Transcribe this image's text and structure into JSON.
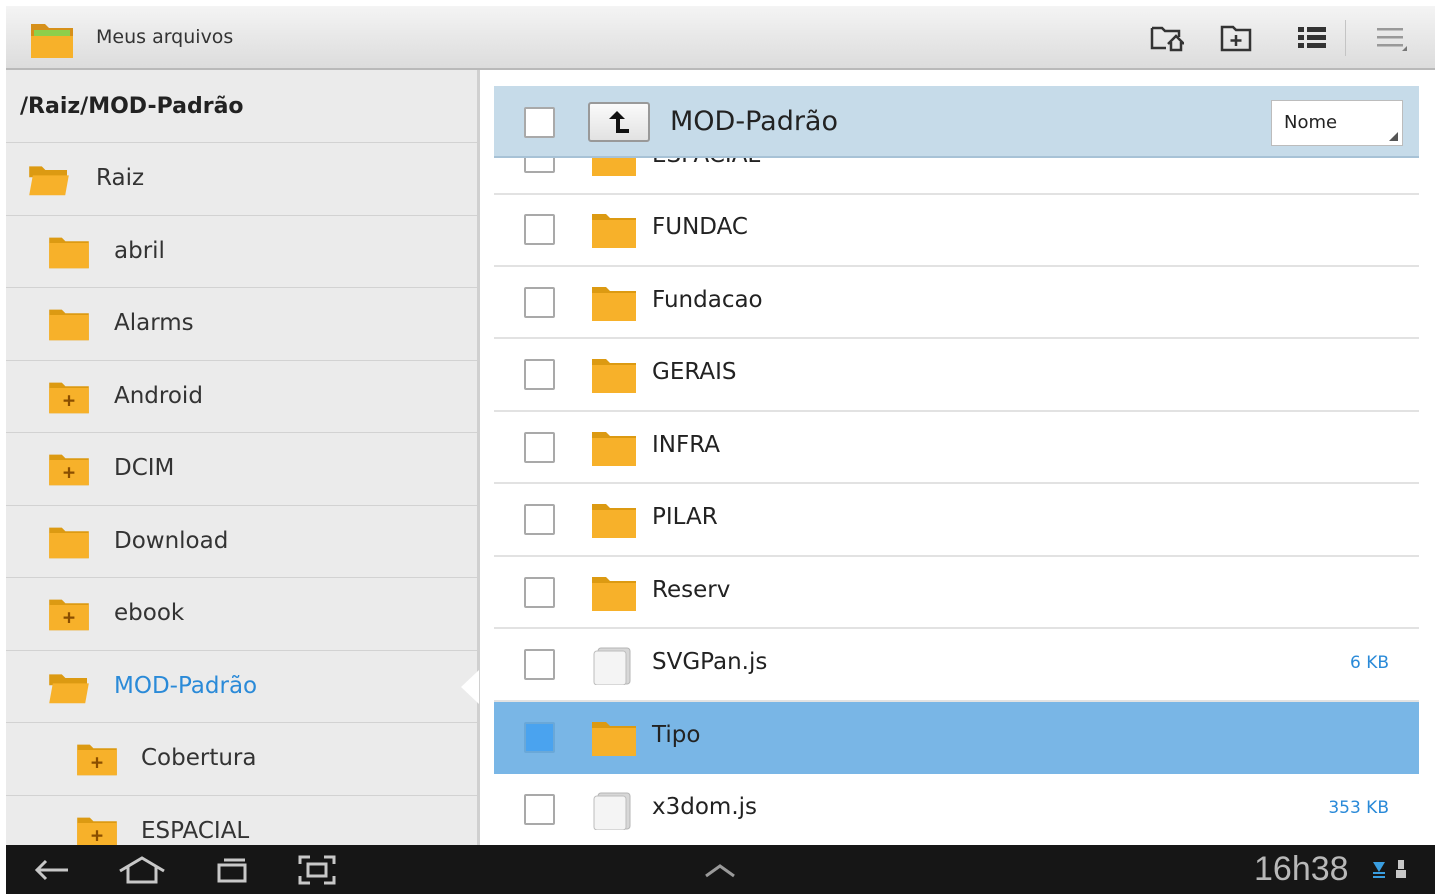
{
  "app": {
    "title": "Meus arquivos",
    "icon": "file-manager-folder-icon"
  },
  "actionbar": {
    "buttons": [
      {
        "name": "home-folder-icon"
      },
      {
        "name": "new-folder-icon"
      },
      {
        "name": "list-view-icon"
      },
      {
        "name": "overflow-menu-icon"
      }
    ]
  },
  "sidebar": {
    "path": "/Raiz/MOD-Padrão",
    "items": [
      {
        "label": "Raiz",
        "level": 0,
        "type": "open-folder"
      },
      {
        "label": "abril",
        "level": 1,
        "type": "folder"
      },
      {
        "label": "Alarms",
        "level": 1,
        "type": "folder"
      },
      {
        "label": "Android",
        "level": 1,
        "type": "folder-plus"
      },
      {
        "label": "DCIM",
        "level": 1,
        "type": "folder-plus"
      },
      {
        "label": "Download",
        "level": 1,
        "type": "folder"
      },
      {
        "label": "ebook",
        "level": 1,
        "type": "folder-plus"
      },
      {
        "label": "MOD-Padrão",
        "level": 1,
        "type": "open-folder",
        "active": true
      },
      {
        "label": "Cobertura",
        "level": 2,
        "type": "folder-plus"
      },
      {
        "label": "ESPACIAL",
        "level": 2,
        "type": "folder-plus"
      }
    ]
  },
  "main": {
    "header": {
      "title": "MOD-Padrão",
      "sort": "Nome"
    },
    "rows": [
      {
        "label": "ESPACIAL",
        "type": "folder",
        "size": ""
      },
      {
        "label": "FUNDAC",
        "type": "folder",
        "size": ""
      },
      {
        "label": "Fundacao",
        "type": "folder",
        "size": ""
      },
      {
        "label": "GERAIS",
        "type": "folder",
        "size": ""
      },
      {
        "label": "INFRA",
        "type": "folder",
        "size": ""
      },
      {
        "label": "PILAR",
        "type": "folder",
        "size": ""
      },
      {
        "label": "Reserv",
        "type": "folder",
        "size": ""
      },
      {
        "label": "SVGPan.js",
        "type": "file",
        "size": "6 KB"
      },
      {
        "label": "Tipo",
        "type": "folder",
        "size": "",
        "selected": true
      },
      {
        "label": "x3dom.js",
        "type": "file",
        "size": "353 KB"
      }
    ]
  },
  "systembar": {
    "time": "16h38",
    "buttons": [
      "back-icon",
      "home-icon",
      "recent-apps-icon",
      "screenshot-icon",
      "chevron-up-icon"
    ],
    "status": [
      "wifi-icon",
      "usb-icon"
    ]
  },
  "colors": {
    "accent": "#2a8ad8",
    "selection": "#79b6e6",
    "header": "#c6dbe9",
    "folder": "#f5a80e"
  }
}
